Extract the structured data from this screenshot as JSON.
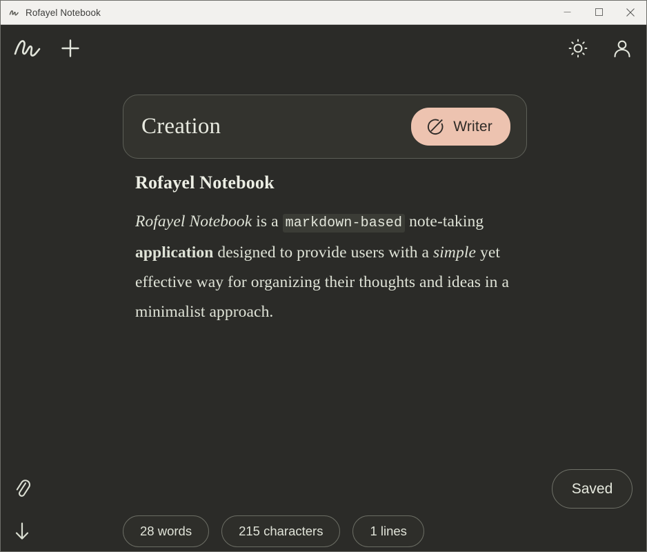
{
  "window": {
    "title": "Rofayel Notebook",
    "app_icon": "scribble-logo-icon",
    "controls": {
      "minimize": "minimize-icon",
      "maximize": "maximize-icon",
      "close": "close-icon"
    }
  },
  "toolbar": {
    "logo_icon": "scribble-logo-icon",
    "new_note_icon": "plus-icon",
    "theme_icon": "sun-brightness-icon",
    "account_icon": "user-account-icon"
  },
  "document": {
    "title": "Creation",
    "mode_button": {
      "label": "Writer",
      "icon": "pen-circle-icon",
      "color": "#edc3b0"
    }
  },
  "editor": {
    "heading": "Rofayel Notebook",
    "paragraph": {
      "italic_open": "Rofayel Notebook",
      "text_1": " is a ",
      "code": "markdown-based",
      "text_2": " note-taking ",
      "bold": "application",
      "text_3": " designed to provide users with a ",
      "italic_mid": "simple",
      "text_4": " yet effective way for organizing their thoughts and ideas in a minimalist approach."
    }
  },
  "rail": {
    "attach_icon": "paperclip-icon",
    "download_icon": "arrow-down-icon"
  },
  "status": {
    "saved_label": "Saved",
    "pills": [
      {
        "label": "28 words"
      },
      {
        "label": "215 characters"
      },
      {
        "label": "1 lines"
      }
    ]
  },
  "colors": {
    "background": "#2b2b28",
    "card": "#33332e",
    "titlebar": "#f2f1ee",
    "accent": "#edc3b0",
    "text": "#e3e6db"
  }
}
